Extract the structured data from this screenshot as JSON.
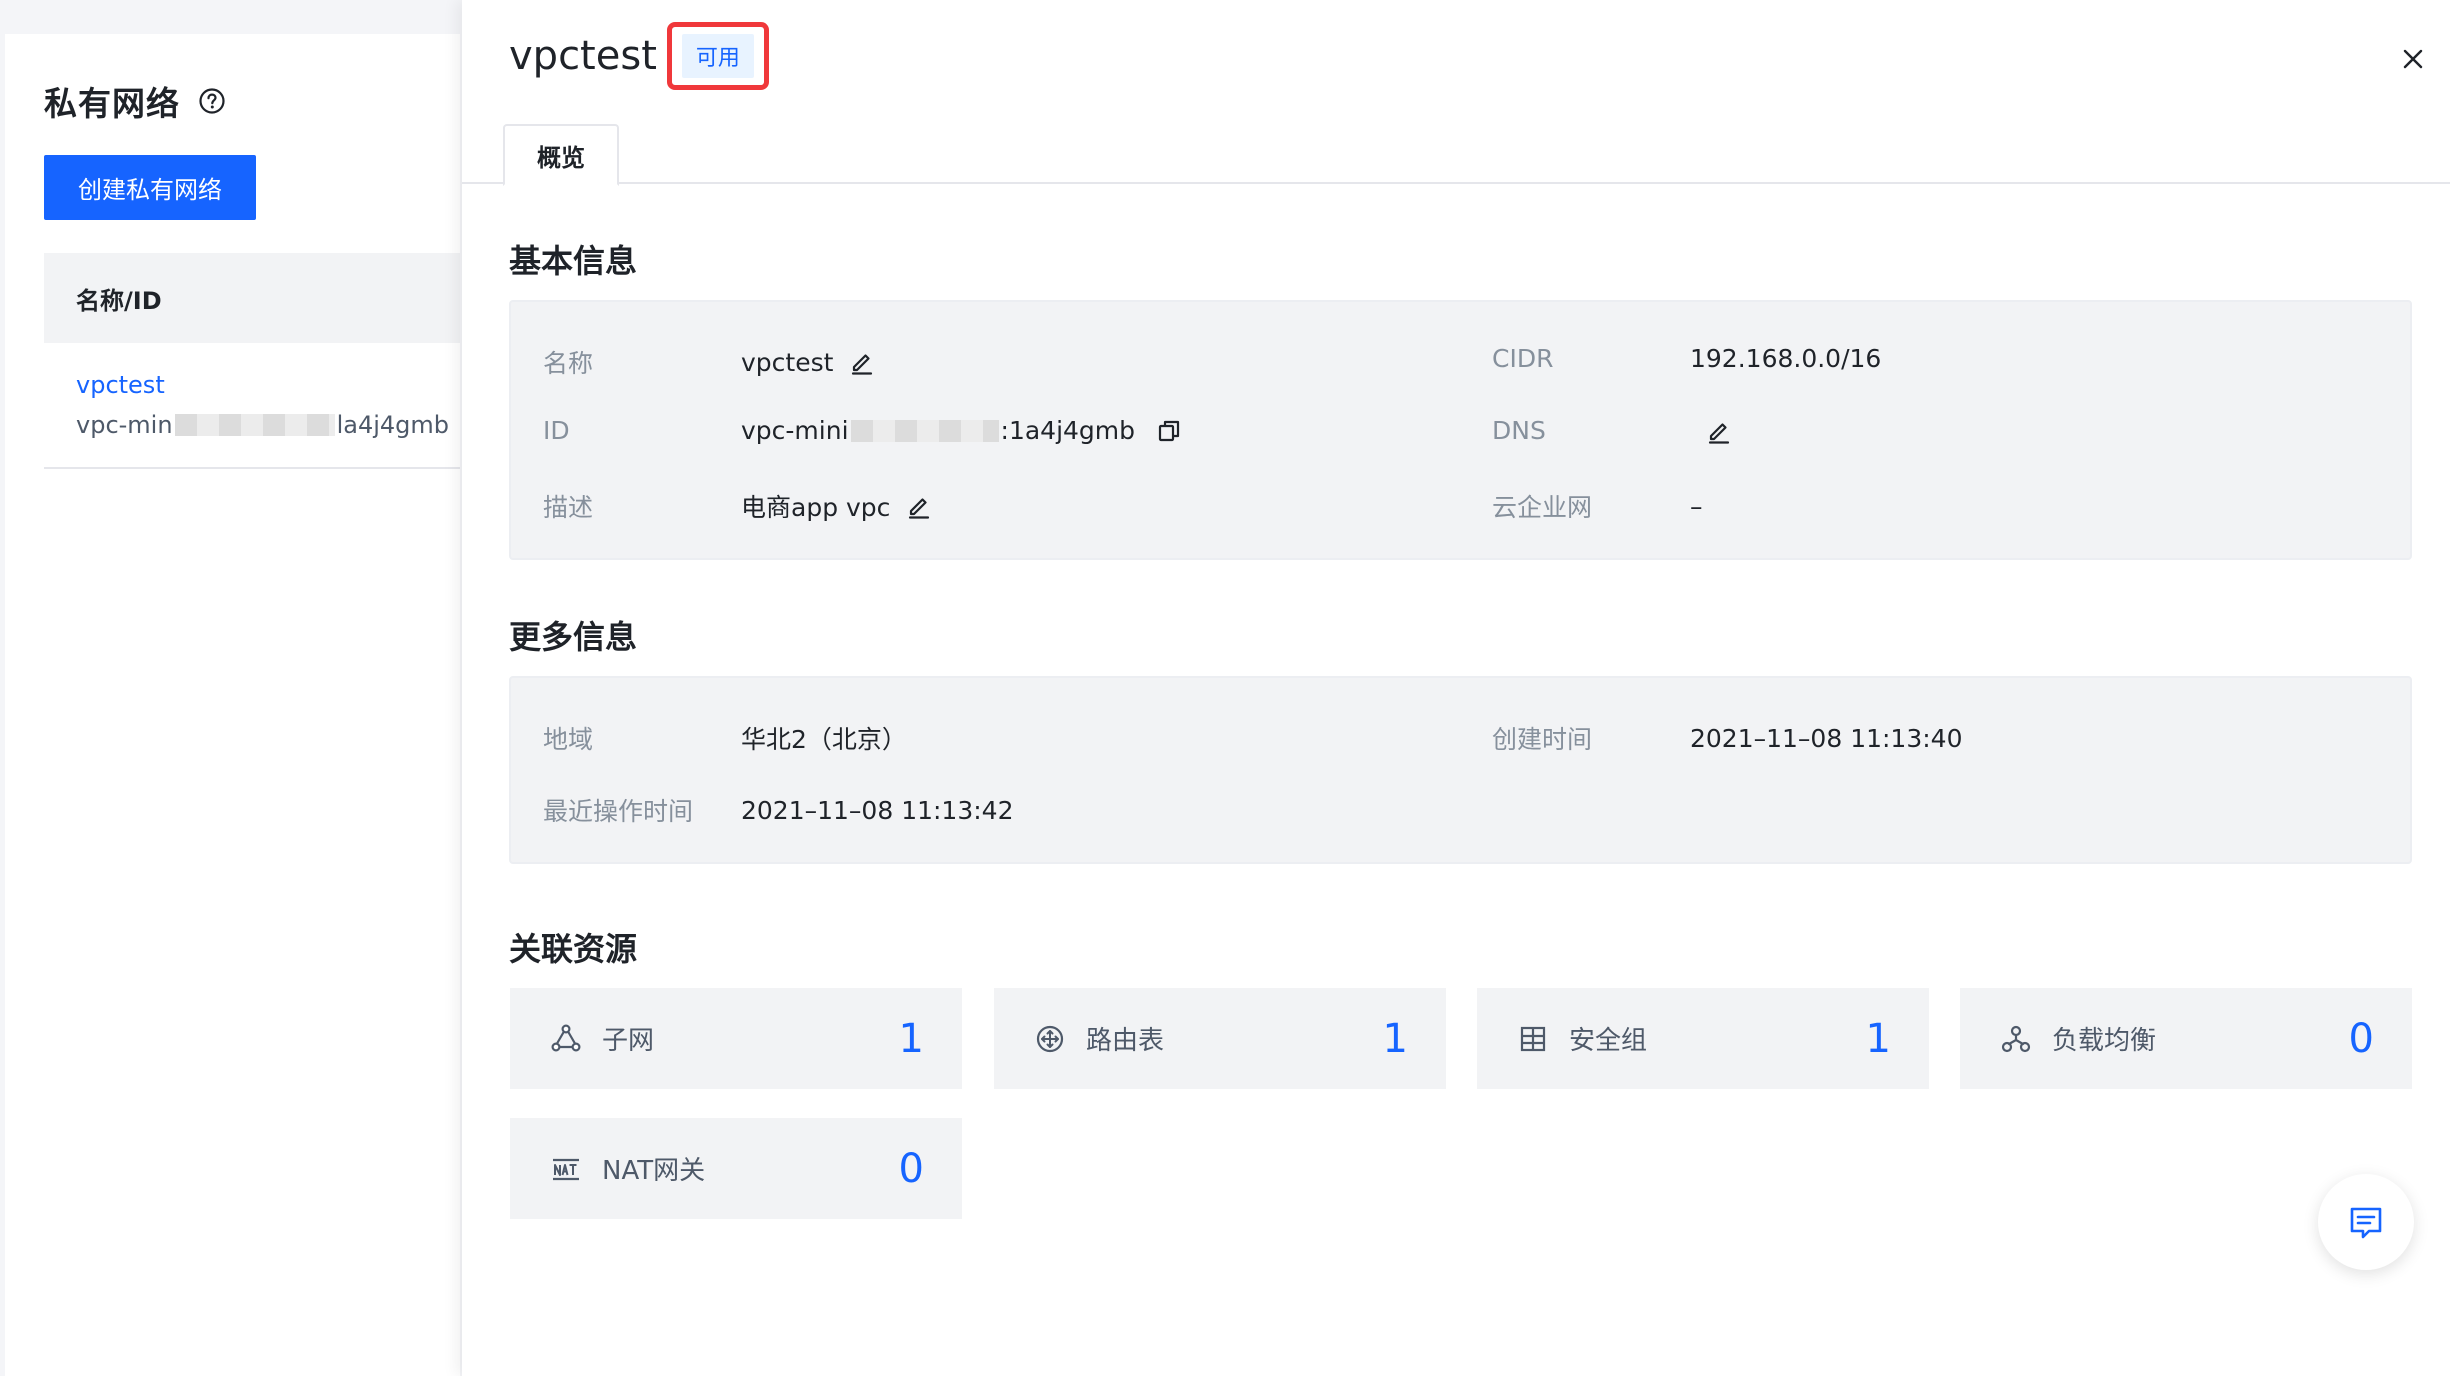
{
  "sidebar": {
    "title": "私有网络",
    "create_button": "创建私有网络",
    "column_header": "名称/ID",
    "items": [
      {
        "name": "vpctest",
        "id_prefix": "vpc-min",
        "id_suffix": "la4j4gmb"
      }
    ]
  },
  "drawer": {
    "title": "vpctest",
    "status": "可用",
    "tab": "概览",
    "basic_section": {
      "title": "基本信息",
      "name_label": "名称",
      "name_value": "vpctest",
      "id_label": "ID",
      "id_prefix": "vpc-mini",
      "id_suffix": ":1a4j4gmb",
      "desc_label": "描述",
      "desc_value": "电商app vpc",
      "cidr_label": "CIDR",
      "cidr_value": "192.168.0.0/16",
      "dns_label": "DNS",
      "cen_label": "云企业网",
      "cen_value": "–"
    },
    "more_section": {
      "title": "更多信息",
      "region_label": "地域",
      "region_value": "华北2（北京）",
      "created_label": "创建时间",
      "created_value": "2021–11–08 11:13:40",
      "updated_label": "最近操作时间",
      "updated_value": "2021–11–08 11:13:42"
    },
    "resources_section": {
      "title": "关联资源",
      "items": [
        {
          "label": "子网",
          "count": "1",
          "icon": "subnet-icon"
        },
        {
          "label": "路由表",
          "count": "1",
          "icon": "route-table-icon"
        },
        {
          "label": "安全组",
          "count": "1",
          "icon": "security-group-icon"
        },
        {
          "label": "负载均衡",
          "count": "0",
          "icon": "load-balancer-icon"
        },
        {
          "label": "NAT网关",
          "count": "0",
          "icon": "nat-gateway-icon"
        }
      ]
    }
  },
  "colors": {
    "primary": "#1664ff",
    "status_border": "#f0383b",
    "status_bg": "#e8f3ff"
  }
}
